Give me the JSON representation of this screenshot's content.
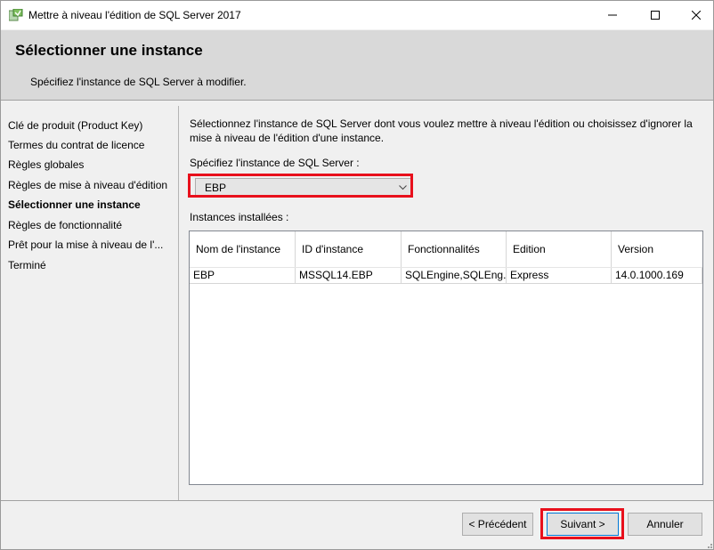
{
  "window": {
    "title": "Mettre à niveau l'édition de SQL Server 2017"
  },
  "header": {
    "title": "Sélectionner une instance",
    "subtitle": "Spécifiez l'instance de SQL Server à modifier."
  },
  "nav": {
    "items": [
      {
        "label": "Clé de produit (Product Key)",
        "active": false
      },
      {
        "label": "Termes du contrat de licence",
        "active": false
      },
      {
        "label": "Règles globales",
        "active": false
      },
      {
        "label": "Règles de mise à niveau d'édition",
        "active": false
      },
      {
        "label": "Sélectionner une instance",
        "active": true
      },
      {
        "label": "Règles de fonctionnalité",
        "active": false
      },
      {
        "label": "Prêt pour la mise à niveau de l'...",
        "active": false
      },
      {
        "label": "Terminé",
        "active": false
      }
    ]
  },
  "main": {
    "description": "Sélectionnez l'instance de SQL Server dont vous voulez mettre à niveau l'édition ou choisissez d'ignorer la mise à niveau de l'édition d'une instance.",
    "instance_label": "Spécifiez l'instance de SQL Server :",
    "instance_value": "EBP",
    "installed_label": "Instances installées :",
    "table": {
      "headers": [
        "Nom de l'instance",
        "ID d'instance",
        "Fonctionnalités",
        "Edition",
        "Version"
      ],
      "rows": [
        [
          "EBP",
          "MSSQL14.EBP",
          "SQLEngine,SQLEng...",
          "Express",
          "14.0.1000.169"
        ]
      ]
    }
  },
  "footer": {
    "prev_label": "< Précédent",
    "next_label": "Suivant >",
    "cancel_label": "Annuler"
  },
  "colors": {
    "highlight": "#e8101c",
    "header_bg": "#d9d9d9",
    "focus_border": "#0078d7"
  }
}
